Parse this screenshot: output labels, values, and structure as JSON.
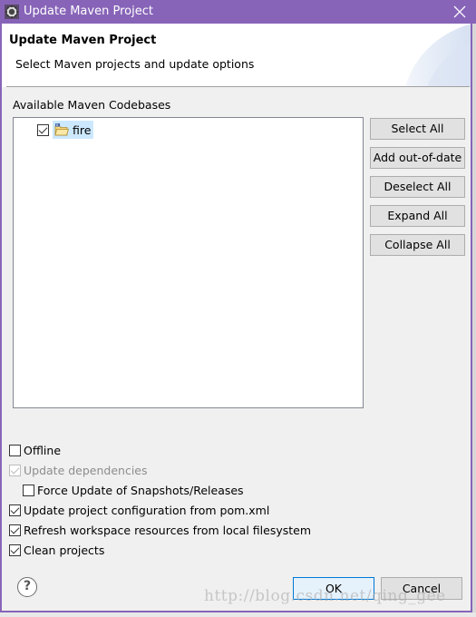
{
  "window": {
    "title": "Update Maven Project",
    "close_icon": "close-icon",
    "app_icon": "eclipse-gear-icon",
    "accent_color": "#8764b8"
  },
  "banner": {
    "heading": "Update Maven Project",
    "description": "Select Maven projects and update options"
  },
  "codebases": {
    "label": "Available Maven Codebases",
    "items": [
      {
        "name": "fire",
        "checked": true,
        "selected": true,
        "icon": "maven-project-folder-icon"
      }
    ]
  },
  "side_buttons": {
    "select_all": "Select All",
    "add_out_of_date": "Add out-of-date",
    "deselect_all": "Deselect All",
    "expand_all": "Expand All",
    "collapse_all": "Collapse All"
  },
  "options": {
    "offline": {
      "label": "Offline",
      "checked": false
    },
    "update_dependencies": {
      "label": "Update dependencies",
      "checked": true,
      "disabled": true
    },
    "force_update": {
      "label": "Force Update of Snapshots/Releases",
      "checked": false
    },
    "update_config": {
      "label": "Update project configuration from pom.xml",
      "checked": true
    },
    "refresh_workspace": {
      "label": "Refresh workspace resources from local filesystem",
      "checked": true
    },
    "clean_projects": {
      "label": "Clean projects",
      "checked": true
    }
  },
  "footer": {
    "help_icon": "help-icon",
    "ok_label": "OK",
    "cancel_label": "Cancel",
    "watermark": "http://blog.csdn.net/qing_gee"
  }
}
